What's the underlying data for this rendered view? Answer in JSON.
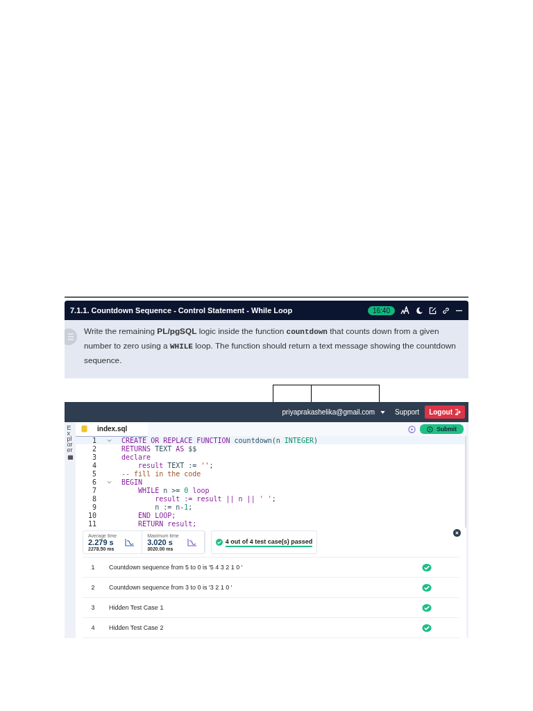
{
  "problem": {
    "title": "7.1.1. Countdown Sequence - Control Statement - While Loop",
    "timer": "16:40",
    "description": [
      {
        "kind": "plain",
        "text": "Write the remaining "
      },
      {
        "kind": "bold",
        "text": "PL/pgSQL"
      },
      {
        "kind": "plain",
        "text": " logic inside the function "
      },
      {
        "kind": "code",
        "text": "countdown"
      },
      {
        "kind": "plain",
        "text": " that counts down from a given number to zero using a "
      },
      {
        "kind": "code",
        "text": "WHILE"
      },
      {
        "kind": "plain",
        "text": " loop. The function should return a text message showing the countdown sequence."
      }
    ]
  },
  "navbar": {
    "user": "priyaprakashelika@gmail.com",
    "support": "Support",
    "logout": "Logout"
  },
  "editor": {
    "sidebar_label": "Explorer",
    "tab": "index.sql",
    "submit": "Submit",
    "lines": [
      {
        "number": "1",
        "foldable": true,
        "selected": true,
        "tokens": [
          {
            "kind": "kw",
            "text": "CREATE OR REPLACE FUNCTION "
          },
          {
            "kind": "plain",
            "text": "countdown(n "
          },
          {
            "kind": "type",
            "text": "INTEGER"
          },
          {
            "kind": "plain",
            "text": ")"
          }
        ]
      },
      {
        "number": "2",
        "foldable": false,
        "selected": false,
        "tokens": [
          {
            "kind": "kw",
            "text": "RETURNS "
          },
          {
            "kind": "plain",
            "text": "TEXT "
          },
          {
            "kind": "kw",
            "text": "AS "
          },
          {
            "kind": "plain",
            "text": "$$"
          }
        ]
      },
      {
        "number": "3",
        "foldable": false,
        "selected": false,
        "tokens": [
          {
            "kind": "kw",
            "text": "declare"
          }
        ]
      },
      {
        "number": "4",
        "foldable": false,
        "selected": false,
        "tokens": [
          {
            "kind": "kw",
            "text": "    result "
          },
          {
            "kind": "plain",
            "text": "TEXT := "
          },
          {
            "kind": "str",
            "text": "''"
          },
          {
            "kind": "plain",
            "text": ";"
          }
        ]
      },
      {
        "number": "5",
        "foldable": false,
        "selected": false,
        "tokens": [
          {
            "kind": "comment",
            "text": "-- fill in the code"
          }
        ]
      },
      {
        "number": "6",
        "foldable": true,
        "selected": false,
        "tokens": [
          {
            "kind": "kw",
            "text": "BEGIN"
          }
        ]
      },
      {
        "number": "7",
        "foldable": false,
        "selected": false,
        "tokens": [
          {
            "kind": "kw",
            "text": "    WHILE "
          },
          {
            "kind": "plain",
            "text": "n >= "
          },
          {
            "kind": "num",
            "text": "0"
          },
          {
            "kind": "kw",
            "text": " loop"
          }
        ]
      },
      {
        "number": "8",
        "foldable": false,
        "selected": false,
        "tokens": [
          {
            "kind": "kw",
            "text": "        result := result || n || "
          },
          {
            "kind": "str",
            "text": "' '"
          },
          {
            "kind": "plain",
            "text": ";"
          }
        ]
      },
      {
        "number": "9",
        "foldable": false,
        "selected": false,
        "tokens": [
          {
            "kind": "plain",
            "text": "        n := n-"
          },
          {
            "kind": "num",
            "text": "1"
          },
          {
            "kind": "plain",
            "text": ";"
          }
        ]
      },
      {
        "number": "10",
        "foldable": false,
        "selected": false,
        "tokens": [
          {
            "kind": "kw",
            "text": "    END LOOP;"
          }
        ]
      },
      {
        "number": "11",
        "foldable": false,
        "selected": false,
        "tokens": [
          {
            "kind": "kw",
            "text": "    RETURN result;"
          }
        ]
      }
    ]
  },
  "results": {
    "stats": [
      {
        "label": "Average time",
        "value": "2.279 s",
        "ms": "2278.50 ms"
      },
      {
        "label": "Maximum time",
        "value": "3.020 s",
        "ms": "3020.00 ms"
      }
    ],
    "summary": "4 out of 4 test case(s) passed",
    "tests": [
      {
        "number": "1",
        "name": "Countdown sequence from 5 to 0 is '5 4 3 2 1 0 '",
        "passed": true
      },
      {
        "number": "2",
        "name": "Countdown sequence from 3 to 0 is '3 2 1 0 '",
        "passed": true
      },
      {
        "number": "3",
        "name": "Hidden Test Case 1",
        "passed": true
      },
      {
        "number": "4",
        "name": "Hidden Test Case 2",
        "passed": true
      }
    ]
  }
}
